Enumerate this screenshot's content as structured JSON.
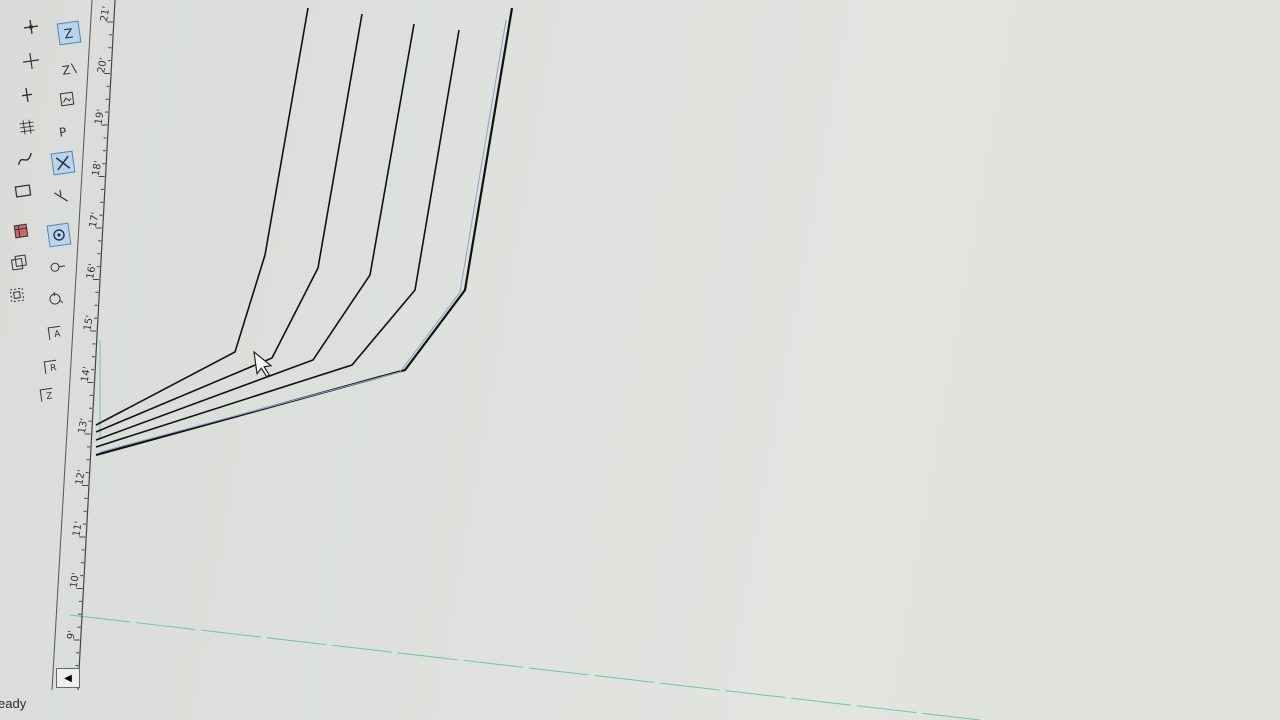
{
  "status": {
    "text": "eady"
  },
  "ruler": {
    "labels": [
      "21'",
      "20'",
      "19'",
      "18'",
      "17'",
      "16'",
      "15'",
      "14'",
      "13'",
      "12'",
      "11'",
      "10'",
      "9'"
    ]
  },
  "toolbar": {
    "tools": [
      {
        "name": "grid-snap-tool-icon",
        "active": false
      },
      {
        "name": "elevation-z-tool-icon",
        "active": true
      },
      {
        "name": "cross-snap-tool-icon",
        "active": false
      },
      {
        "name": "z-axis-tool-icon",
        "active": false
      },
      {
        "name": "point-tool-icon",
        "active": false
      },
      {
        "name": "image-frame-tool-icon",
        "active": false
      },
      {
        "name": "grid-lines-tool-icon",
        "active": false
      },
      {
        "name": "p-point-tool-icon",
        "active": false
      },
      {
        "name": "curve-tool-icon",
        "active": false
      },
      {
        "name": "intersect-tool-icon",
        "active": true
      },
      {
        "name": "rectangle-tool-icon",
        "active": false
      },
      {
        "name": "trim-tool-icon",
        "active": false
      },
      {
        "name": "solid-tool-icon",
        "active": false
      },
      {
        "name": "rotate-target-tool-icon",
        "active": true
      },
      {
        "name": "layers-tool-icon",
        "active": false
      },
      {
        "name": "visibility-tool-icon",
        "active": false
      },
      {
        "name": "frame-select-tool-icon",
        "active": false
      },
      {
        "name": "rotate-3d-tool-icon",
        "active": false
      },
      {
        "name": "dimension-a-tool-icon",
        "active": false
      },
      {
        "name": "dimension-r-tool-icon",
        "active": false
      },
      {
        "name": "dimension-z-tool-icon",
        "active": false
      }
    ]
  },
  "colors": {
    "accent": "#4f86bf",
    "guide_line": "#6fc7a8",
    "drawing_line": "#111111"
  }
}
